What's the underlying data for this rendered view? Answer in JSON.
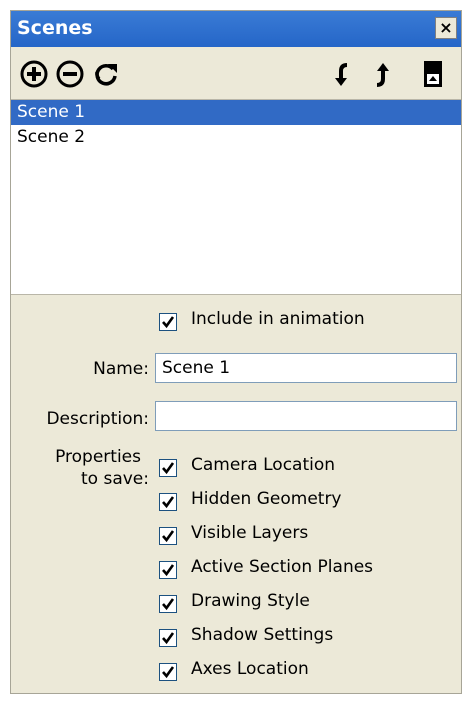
{
  "window": {
    "title": "Scenes",
    "close_label": "×"
  },
  "toolbar": {
    "icons": [
      "add-scene-icon",
      "remove-scene-icon",
      "update-scene-icon",
      "move-down-icon",
      "move-up-icon",
      "details-toggle-icon"
    ]
  },
  "scenes": {
    "items": [
      {
        "label": "Scene 1",
        "selected": true
      },
      {
        "label": "Scene 2",
        "selected": false
      }
    ]
  },
  "form": {
    "include_animation": {
      "label": "Include in animation",
      "checked": true
    },
    "name": {
      "label": "Name:",
      "value": "Scene 1"
    },
    "description": {
      "label": "Description:",
      "value": ""
    },
    "properties_label_line1": "Properties",
    "properties_label_line2": "to save:",
    "properties": [
      {
        "label": "Camera Location",
        "checked": true
      },
      {
        "label": "Hidden Geometry",
        "checked": true
      },
      {
        "label": "Visible Layers",
        "checked": true
      },
      {
        "label": "Active Section Planes",
        "checked": true
      },
      {
        "label": "Drawing Style",
        "checked": true
      },
      {
        "label": "Shadow Settings",
        "checked": true
      },
      {
        "label": "Axes Location",
        "checked": true
      }
    ]
  },
  "colors": {
    "titlebar": "#2566c8",
    "selection": "#316ac5",
    "panel_bg": "#ece9d8"
  }
}
